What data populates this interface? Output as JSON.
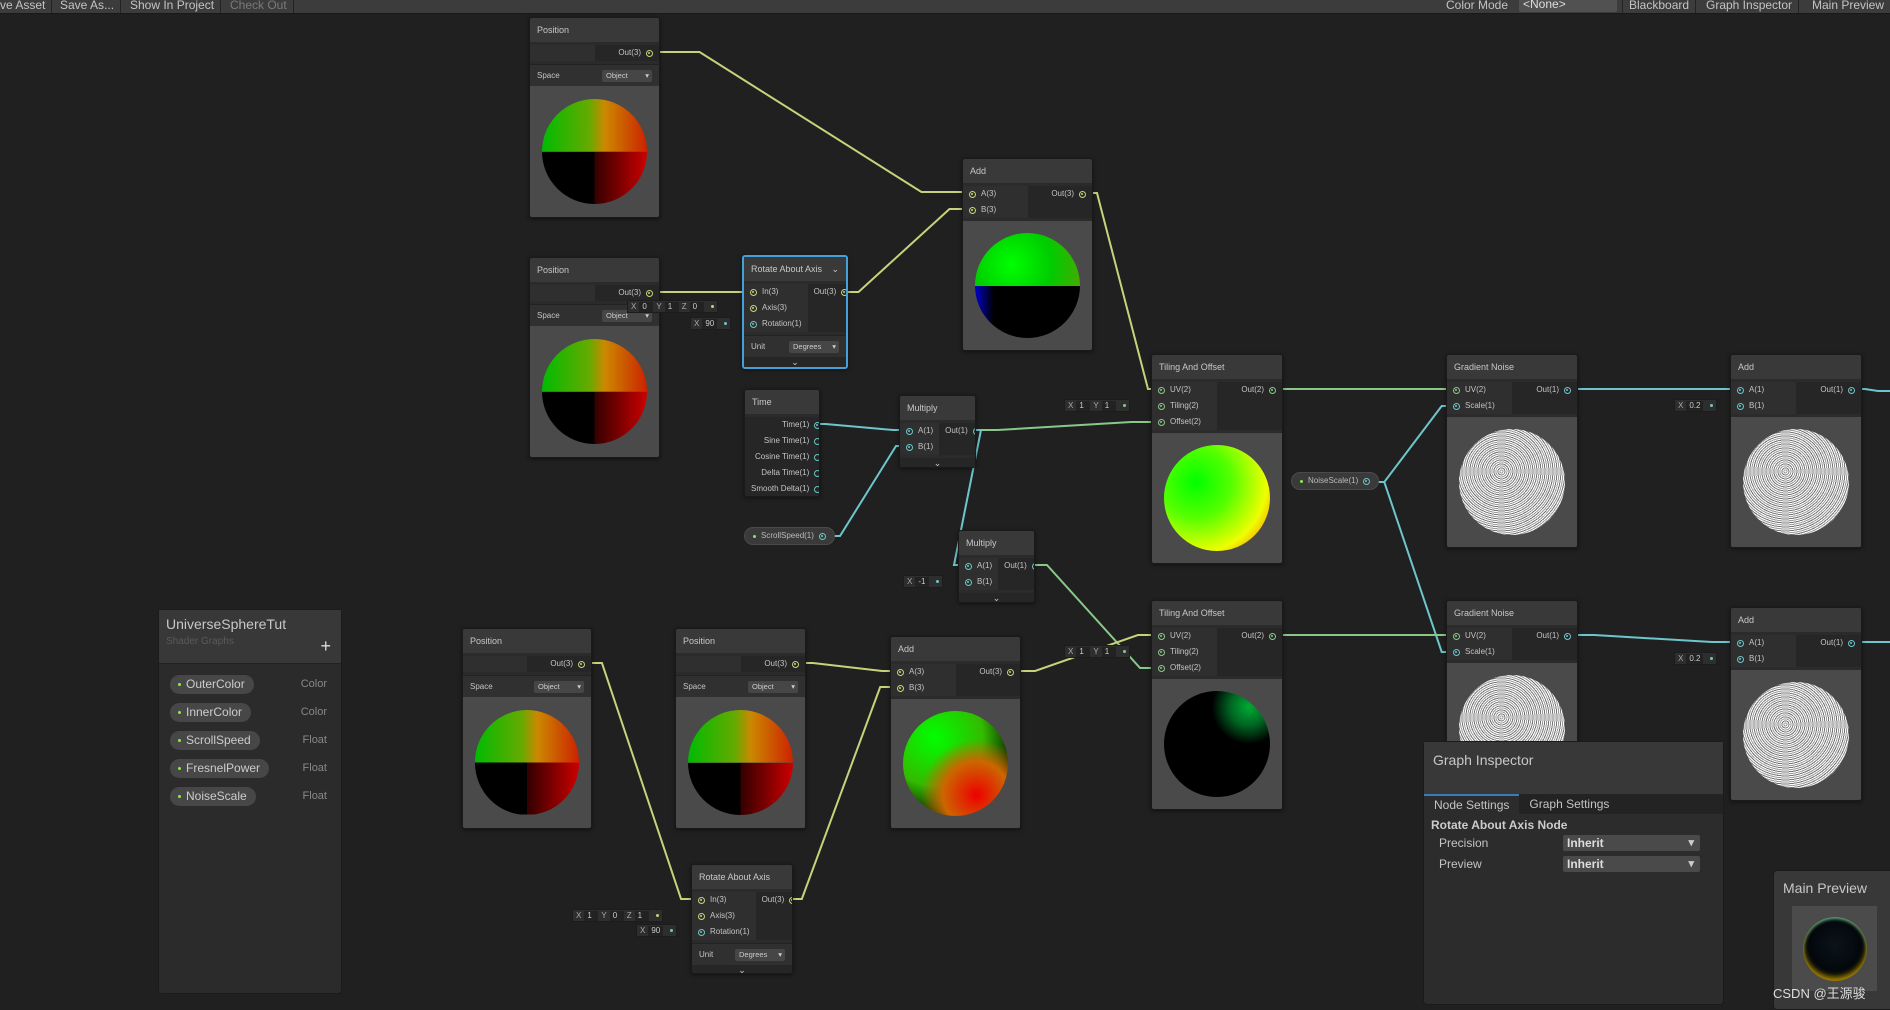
{
  "toolbar": {
    "left": [
      "ve Asset",
      "Save As...",
      "Show In Project",
      "Check Out"
    ],
    "color_mode_label": "Color Mode",
    "color_mode_value": "<None>",
    "right": [
      "Blackboard",
      "Graph Inspector",
      "Main Preview"
    ]
  },
  "nodes": [
    {
      "id": "pos1",
      "title": "Position",
      "inputs": [],
      "outputs": [
        "Out(3)"
      ],
      "settings": [
        [
          "Space",
          "Object"
        ]
      ],
      "preview": "position"
    },
    {
      "id": "pos2",
      "title": "Position",
      "inputs": [],
      "outputs": [
        "Out(3)"
      ],
      "settings": [
        [
          "Space",
          "Object"
        ]
      ],
      "preview": "position"
    },
    {
      "id": "rot1",
      "title": "Rotate About Axis",
      "inputs": [
        "In(3)",
        "Axis(3)",
        "Rotation(1)"
      ],
      "outputs": [
        "Out(3)"
      ],
      "settings": [
        [
          "Unit",
          "Degrees"
        ]
      ],
      "chevron": "⌄",
      "selected": true
    },
    {
      "id": "add1",
      "title": "Add",
      "inputs": [
        "A(3)",
        "B(3)"
      ],
      "outputs": [
        "Out(3)"
      ],
      "preview": "add-blue"
    },
    {
      "id": "time",
      "title": "Time",
      "inputs": [],
      "outputs": [
        "Time(1)",
        "Sine Time(1)",
        "Cosine Time(1)",
        "Delta Time(1)",
        "Smooth Delta(1)"
      ]
    },
    {
      "id": "mul1",
      "title": "Multiply",
      "inputs": [
        "A(1)",
        "B(1)"
      ],
      "outputs": [
        "Out(1)"
      ],
      "chevron": "⌄"
    },
    {
      "id": "mul2",
      "title": "Multiply",
      "inputs": [
        "A(1)",
        "B(1)"
      ],
      "outputs": [
        "Out(1)"
      ],
      "chevron": "⌄"
    },
    {
      "id": "til1",
      "title": "Tiling And Offset",
      "inputs": [
        "UV(2)",
        "Tiling(2)",
        "Offset(2)"
      ],
      "outputs": [
        "Out(2)"
      ],
      "preview": "tiling-yellow"
    },
    {
      "id": "gn1",
      "title": "Gradient Noise",
      "inputs": [
        "UV(2)",
        "Scale(1)"
      ],
      "outputs": [
        "Out(1)"
      ],
      "preview": "noise"
    },
    {
      "id": "addr1",
      "title": "Add",
      "inputs": [
        "A(1)",
        "B(1)"
      ],
      "outputs": [
        "Out(1)"
      ],
      "preview": "noise"
    },
    {
      "id": "til2",
      "title": "Tiling And Offset",
      "inputs": [
        "UV(2)",
        "Tiling(2)",
        "Offset(2)"
      ],
      "outputs": [
        "Out(2)"
      ],
      "preview": "tiling-black"
    },
    {
      "id": "gn2",
      "title": "Gradient Noise",
      "inputs": [
        "UV(2)",
        "Scale(1)"
      ],
      "outputs": [
        "Out(1)"
      ],
      "preview": "noise"
    },
    {
      "id": "addr2",
      "title": "Add",
      "inputs": [
        "A(1)",
        "B(1)"
      ],
      "outputs": [
        "Out(1)"
      ],
      "preview": "noise"
    },
    {
      "id": "pos3",
      "title": "Position",
      "inputs": [],
      "outputs": [
        "Out(3)"
      ],
      "settings": [
        [
          "Space",
          "Object"
        ]
      ],
      "preview": "position"
    },
    {
      "id": "pos4",
      "title": "Position",
      "inputs": [],
      "outputs": [
        "Out(3)"
      ],
      "settings": [
        [
          "Space",
          "Object"
        ]
      ],
      "preview": "position"
    },
    {
      "id": "add3",
      "title": "Add",
      "inputs": [
        "A(3)",
        "B(3)"
      ],
      "outputs": [
        "Out(3)"
      ],
      "preview": "add-mixed"
    },
    {
      "id": "rot2",
      "title": "Rotate About Axis",
      "inputs": [
        "In(3)",
        "Axis(3)",
        "Rotation(1)"
      ],
      "outputs": [
        "Out(3)"
      ],
      "settings": [
        [
          "Unit",
          "Degrees"
        ]
      ],
      "chevron": "⌄"
    }
  ],
  "inline_fields": [
    {
      "id": "rot1-axis",
      "fields": [
        [
          "X",
          "0"
        ],
        [
          "Y",
          "1"
        ],
        [
          "Z",
          "0"
        ]
      ]
    },
    {
      "id": "rot1-rot",
      "fields": [
        [
          "X",
          "90"
        ]
      ]
    },
    {
      "id": "til1-tiling",
      "fields": [
        [
          "X",
          "1"
        ],
        [
          "Y",
          "1"
        ]
      ]
    },
    {
      "id": "mul2-b",
      "fields": [
        [
          "X",
          "-1"
        ]
      ]
    },
    {
      "id": "addr1-b",
      "fields": [
        [
          "X",
          "0.2"
        ]
      ]
    },
    {
      "id": "til2-tiling",
      "fields": [
        [
          "X",
          "1"
        ],
        [
          "Y",
          "1"
        ]
      ]
    },
    {
      "id": "addr2-b",
      "fields": [
        [
          "X",
          "0.2"
        ]
      ]
    },
    {
      "id": "rot2-axis",
      "fields": [
        [
          "X",
          "1"
        ],
        [
          "Y",
          "0"
        ],
        [
          "Z",
          "1"
        ]
      ]
    },
    {
      "id": "rot2-rot",
      "fields": [
        [
          "X",
          "90"
        ]
      ]
    }
  ],
  "property_nodes": {
    "scroll_speed": "ScrollSpeed(1)",
    "noise_scale": "NoiseScale(1)"
  },
  "blackboard": {
    "title": "UniverseSphereTut",
    "subtitle": "Shader Graphs",
    "add": "+",
    "properties": [
      {
        "name": "OuterColor",
        "type": "Color"
      },
      {
        "name": "InnerColor",
        "type": "Color"
      },
      {
        "name": "ScrollSpeed",
        "type": "Float"
      },
      {
        "name": "FresnelPower",
        "type": "Float"
      },
      {
        "name": "NoiseScale",
        "type": "Float"
      }
    ]
  },
  "graph_inspector": {
    "title": "Graph Inspector",
    "tabs": [
      "Node Settings",
      "Graph Settings"
    ],
    "node_title": "Rotate About Axis Node",
    "fields": [
      {
        "label": "Precision",
        "value": "Inherit"
      },
      {
        "label": "Preview",
        "value": "Inherit"
      }
    ]
  },
  "main_preview": {
    "title": "Main Preview"
  },
  "watermark": "CSDN @王源骏",
  "colors": {
    "vec3": "#c9d27a",
    "vec2": "#88c98a",
    "float": "#6cc6cc",
    "selection": "#44a0d8",
    "property_dot": "#8ee044"
  }
}
